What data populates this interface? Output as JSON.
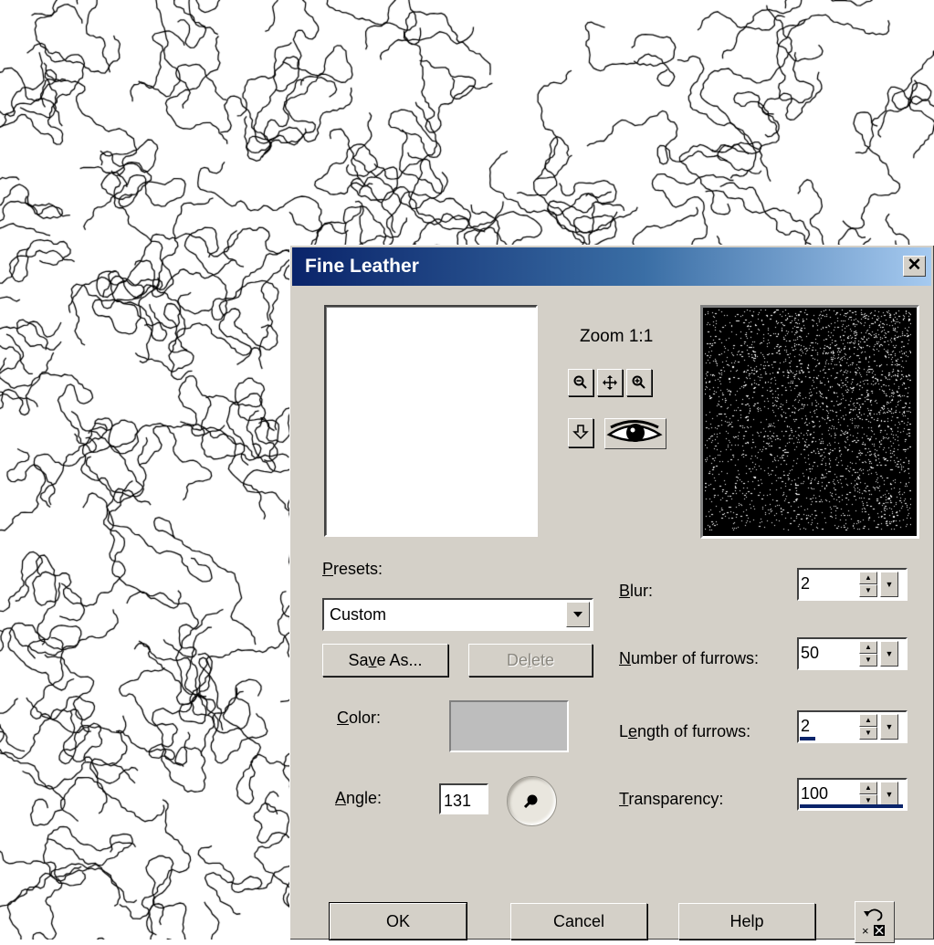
{
  "dialog": {
    "title": "Fine Leather",
    "close_icon": "close-icon"
  },
  "preview": {
    "zoom_label": "Zoom 1:1",
    "tools": [
      "zoom-out-icon",
      "pan-icon",
      "zoom-in-icon",
      "proof-arrow-icon",
      "eye-icon"
    ]
  },
  "presets": {
    "label_pre": "",
    "label_ul": "P",
    "label_post": "resets:",
    "selected": "Custom",
    "save_as_pre": "Sa",
    "save_as_ul": "v",
    "save_as_post": "e As...",
    "delete_pre": "De",
    "delete_ul": "l",
    "delete_post": "ete"
  },
  "color": {
    "label_ul": "C",
    "label_post": "olor:",
    "value": "#bdbdbd"
  },
  "angle": {
    "label_ul": "A",
    "label_post": "ngle:",
    "value": "131"
  },
  "params": [
    {
      "label_pre": "",
      "label_ul": "B",
      "label_post": "lur:",
      "value": "2",
      "level": 0
    },
    {
      "label_pre": "",
      "label_ul": "N",
      "label_post": "umber of furrows:",
      "value": "50",
      "level": 0
    },
    {
      "label_pre": "L",
      "label_ul": "e",
      "label_post": "ngth of furrows:",
      "value": "2",
      "level": 0.15
    },
    {
      "label_pre": "",
      "label_ul": "T",
      "label_post": "ransparency:",
      "value": "100",
      "level": 1.0
    }
  ],
  "buttons": {
    "ok": "OK",
    "cancel": "Cancel",
    "help": "Help",
    "reset_icon": "reset-icon"
  }
}
